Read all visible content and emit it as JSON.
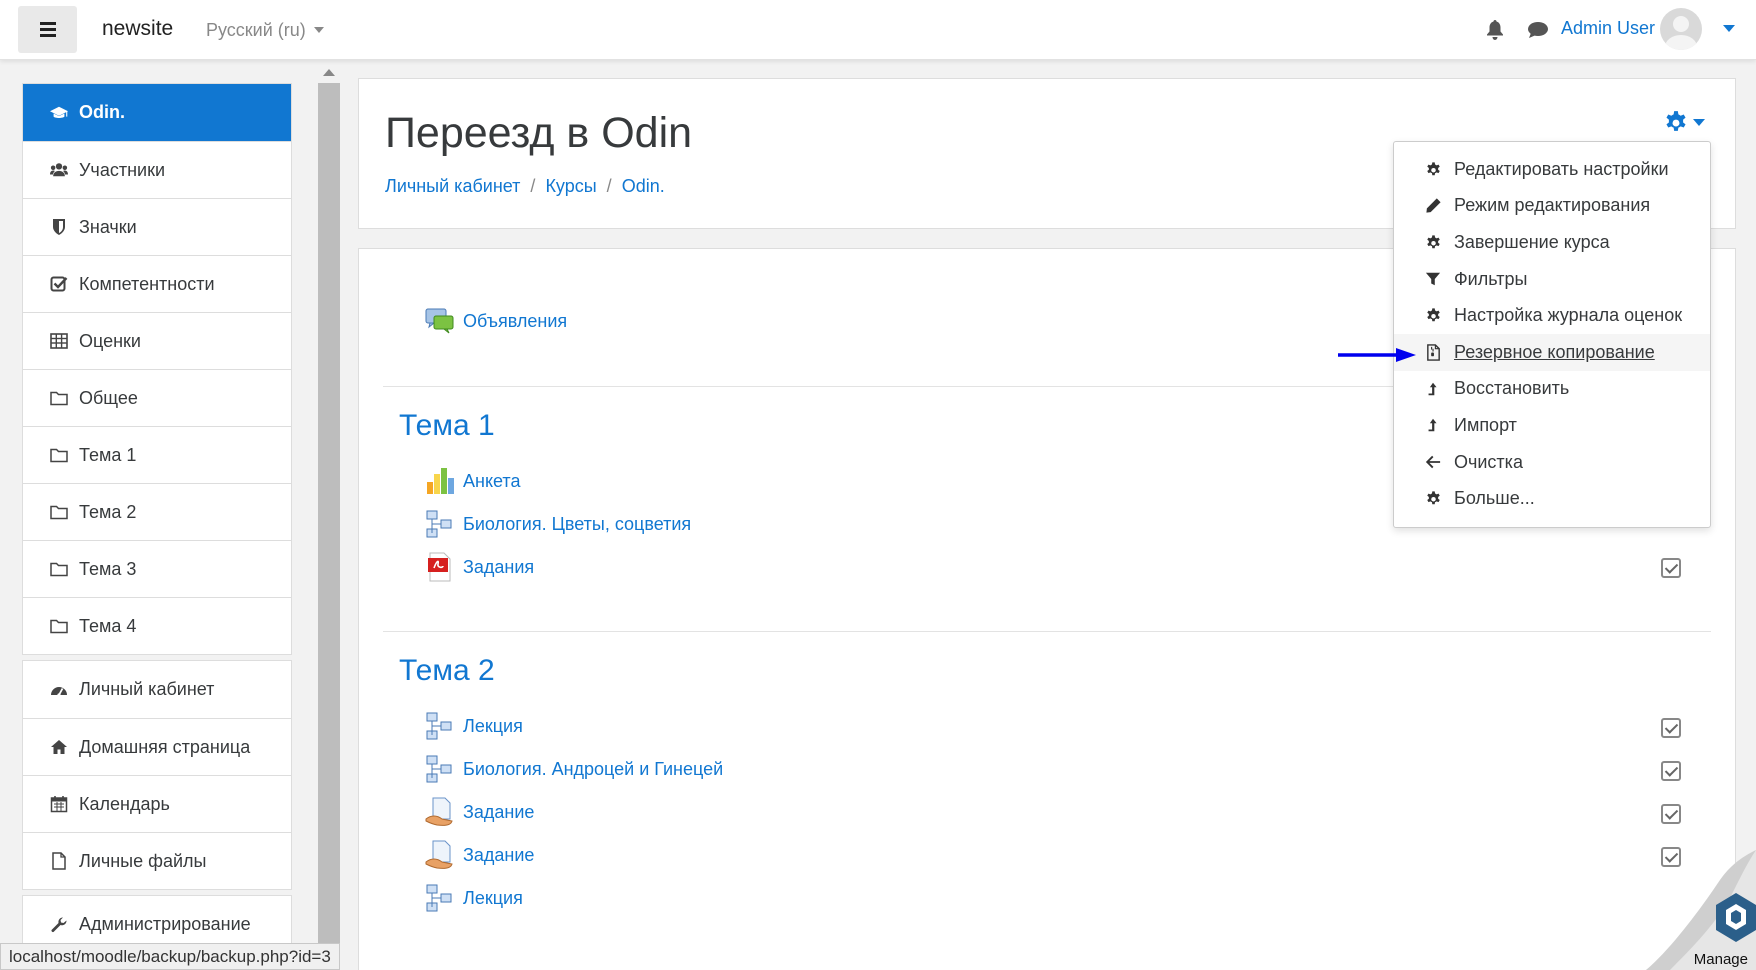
{
  "navbar": {
    "brand": "newsite",
    "language": "Русский (ru)",
    "user_name": "Admin User"
  },
  "sidebar": {
    "course_items": [
      {
        "label": "Odin.",
        "icon": "graduation-cap-icon",
        "active": true
      },
      {
        "label": "Участники",
        "icon": "users-icon"
      },
      {
        "label": "Значки",
        "icon": "shield-icon"
      },
      {
        "label": "Компетентности",
        "icon": "check-square-icon"
      },
      {
        "label": "Оценки",
        "icon": "table-icon"
      },
      {
        "label": "Общее",
        "icon": "folder-icon"
      },
      {
        "label": "Тема 1",
        "icon": "folder-icon"
      },
      {
        "label": "Тема 2",
        "icon": "folder-icon"
      },
      {
        "label": "Тема 3",
        "icon": "folder-icon"
      },
      {
        "label": "Тема 4",
        "icon": "folder-icon"
      }
    ],
    "site_items": [
      {
        "label": "Личный кабинет",
        "icon": "dashboard-icon"
      },
      {
        "label": "Домашняя страница",
        "icon": "home-icon"
      },
      {
        "label": "Календарь",
        "icon": "calendar-icon"
      },
      {
        "label": "Личные файлы",
        "icon": "file-icon"
      }
    ],
    "admin_items": [
      {
        "label": "Администрирование",
        "icon": "wrench-icon"
      }
    ]
  },
  "header": {
    "title": "Переезд в Odin",
    "breadcrumb": [
      "Личный кабинет",
      "Курсы",
      "Odin."
    ]
  },
  "course": {
    "general": {
      "activities": [
        {
          "label": "Объявления",
          "icon": "forum-icon"
        }
      ]
    },
    "sections": [
      {
        "title": "Тема 1",
        "activities": [
          {
            "label": "Анкета",
            "icon": "feedback-chart-icon"
          },
          {
            "label": "Биология. Цветы, соцветия",
            "icon": "lesson-icon"
          },
          {
            "label": "Задания",
            "icon": "pdf-icon"
          }
        ]
      },
      {
        "title": "Тема 2",
        "activities": [
          {
            "label": "Лекция",
            "icon": "lesson-icon"
          },
          {
            "label": "Биология. Андроцей и Гинецей",
            "icon": "lesson-icon"
          },
          {
            "label": "Задание",
            "icon": "assignment-icon"
          },
          {
            "label": "Задание",
            "icon": "assignment-icon"
          },
          {
            "label": "Лекция",
            "icon": "lesson-icon"
          }
        ]
      }
    ]
  },
  "course_menu": {
    "items": [
      {
        "label": "Редактировать настройки",
        "icon": "gear-icon"
      },
      {
        "label": "Режим редактирования",
        "icon": "pencil-icon"
      },
      {
        "label": "Завершение курса",
        "icon": "gear-icon"
      },
      {
        "label": "Фильтры",
        "icon": "filter-icon"
      },
      {
        "label": "Настройка журнала оценок",
        "icon": "gear-icon"
      },
      {
        "label": "Резервное копирование",
        "icon": "file-archive-icon",
        "hovered": true
      },
      {
        "label": "Восстановить",
        "icon": "level-up-icon"
      },
      {
        "label": "Импорт",
        "icon": "level-up-icon"
      },
      {
        "label": "Очистка",
        "icon": "arrow-left-icon"
      },
      {
        "label": "Больше...",
        "icon": "gear-icon"
      }
    ]
  },
  "statusbar": {
    "url": "localhost/moodle/backup/backup.php?id=3"
  },
  "manage": {
    "label": "Manage"
  },
  "colors": {
    "accent": "#1177d1",
    "arrow": "#0000ee"
  }
}
